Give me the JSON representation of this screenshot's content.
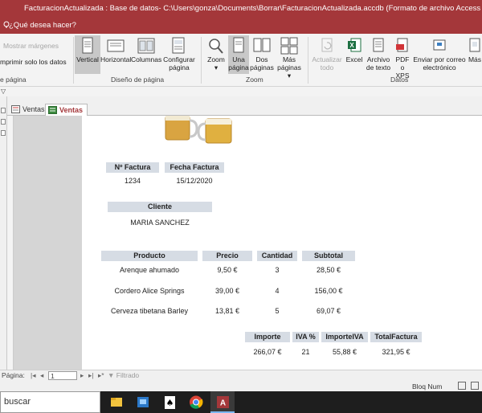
{
  "window": {
    "title": "FacturacionActualizada : Base de datos- C:\\Users\\gonza\\Documents\\Borrar\\FacturacionActualizada.accdb (Formato de archivo Access 2007 - 2016)  -  Access",
    "tell_me": "¿Qué desea hacer?"
  },
  "ribbon": {
    "show_margins": "Mostrar márgenes",
    "print_data_only": "mprimir solo los datos",
    "page_size_group": "e página",
    "layout": {
      "vertical": "Vertical",
      "horizontal": "Horizontal",
      "columns": "Columnas",
      "configure_1": "Configurar",
      "configure_2": "página",
      "group": "Diseño de página"
    },
    "zoom": {
      "zoom": "Zoom",
      "one_1": "Una",
      "one_2": "página",
      "two_1": "Dos",
      "two_2": "páginas",
      "more_1": "Más",
      "more_2": "páginas",
      "group": "Zoom"
    },
    "data": {
      "refresh_1": "Actualizar",
      "refresh_2": "todo",
      "excel": "Excel",
      "text_1": "Archivo",
      "text_2": "de texto",
      "pdf_1": "PDF",
      "pdf_2": "o XPS",
      "email_1": "Enviar por correo",
      "email_2": "electrónico",
      "more": "Más",
      "group": "Datos"
    }
  },
  "tabs": [
    {
      "label": "Ventas"
    },
    {
      "label": "Ventas"
    }
  ],
  "report": {
    "invoice_no_header": "Nº Factura",
    "invoice_date_header": "Fecha Factura",
    "invoice_no": "1234",
    "invoice_date": "15/12/2020",
    "client_header": "Cliente",
    "client": "MARIA SANCHEZ",
    "columns": [
      "Producto",
      "Precio",
      "Cantidad",
      "Subtotal"
    ],
    "rows": [
      {
        "product": "Arenque ahumado",
        "price": "9,50 €",
        "qty": "3",
        "subtotal": "28,50 €"
      },
      {
        "product": "Cordero Alice Springs",
        "price": "39,00 €",
        "qty": "4",
        "subtotal": "156,00 €"
      },
      {
        "product": "Cerveza tibetana Barley",
        "price": "13,81 €",
        "qty": "5",
        "subtotal": "69,07 €"
      }
    ],
    "totals_headers": [
      "Importe",
      "IVA %",
      "ImporteIVA",
      "TotalFactura"
    ],
    "totals": [
      "266,07 €",
      "21",
      "55,88 €",
      "321,95 €"
    ]
  },
  "status": {
    "page_label": "Página:",
    "page_value": "1",
    "filter": "Filtrado",
    "bloq_num": "Bloq Num"
  },
  "taskbar": {
    "search": "buscar"
  },
  "colors": {
    "title_bar": "#a4373a",
    "header_fill": "#d6dce4",
    "excel_green": "#1d6f42",
    "pdf_red": "#d13438"
  }
}
